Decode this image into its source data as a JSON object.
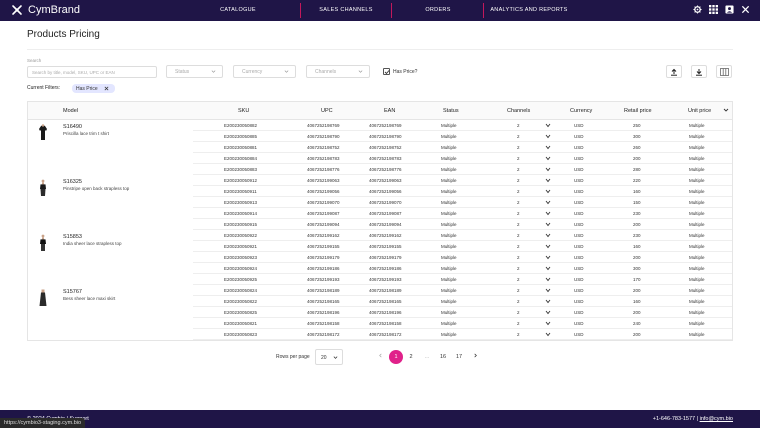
{
  "brand": {
    "name": "CymBrand"
  },
  "nav": {
    "items": [
      {
        "label": "CATALOGUE"
      },
      {
        "label": "SALES CHANNELS"
      },
      {
        "label": "ORDERS"
      },
      {
        "label": "ANALYTICS AND REPORTS"
      }
    ],
    "icons": [
      "gear-icon",
      "apps-grid-icon",
      "user-box-icon",
      "close-icon"
    ]
  },
  "page": {
    "title": "Products Pricing"
  },
  "search": {
    "label": "Search",
    "placeholder": "Search by title, model, SKU, UPC or EAN"
  },
  "filters": {
    "status": "Status",
    "currency": "Currency",
    "channels": "Channels",
    "has_price_checked": true,
    "has_price_label": "Has Price?"
  },
  "current_filters": {
    "label": "Current Filters:",
    "chips": [
      "Has Price"
    ]
  },
  "toolbar": {
    "buttons": [
      "upload-icon",
      "download-icon",
      "columns-icon"
    ]
  },
  "table": {
    "columns": [
      "Model",
      "SKU",
      "UPC",
      "EAN",
      "Status",
      "Channels",
      "Currency",
      "Retail price",
      "Unit price"
    ],
    "groups": [
      {
        "model": "S16490",
        "name": "Priscilla lace trim t shirt",
        "rows": [
          {
            "sku": "E200230050882",
            "upc": "4067252198769",
            "ean": "4067252198769",
            "status": "Multiple",
            "channels": "2",
            "currency": "USD",
            "retail": "250",
            "unit": "Multiple"
          },
          {
            "sku": "E200230050885",
            "upc": "4067252198790",
            "ean": "4067252198790",
            "status": "Multiple",
            "channels": "2",
            "currency": "USD",
            "retail": "300",
            "unit": "Multiple"
          },
          {
            "sku": "E200230050881",
            "upc": "4067252198752",
            "ean": "4067252198752",
            "status": "Multiple",
            "channels": "2",
            "currency": "USD",
            "retail": "260",
            "unit": "Multiple"
          },
          {
            "sku": "E200230050884",
            "upc": "4067252198783",
            "ean": "4067252198783",
            "status": "Multiple",
            "channels": "2",
            "currency": "USD",
            "retail": "200",
            "unit": "Multiple"
          },
          {
            "sku": "E200230050883",
            "upc": "4067252198776",
            "ean": "4067252198776",
            "status": "Multiple",
            "channels": "2",
            "currency": "USD",
            "retail": "280",
            "unit": "Multiple"
          }
        ]
      },
      {
        "model": "S16325",
        "name": "Pinstripe open back strapless top",
        "rows": [
          {
            "sku": "E200230050912",
            "upc": "4067252199063",
            "ean": "4067252199063",
            "status": "Multiple",
            "channels": "2",
            "currency": "USD",
            "retail": "220",
            "unit": "Multiple"
          },
          {
            "sku": "E200230050911",
            "upc": "4067252199056",
            "ean": "4067252199056",
            "status": "Multiple",
            "channels": "2",
            "currency": "USD",
            "retail": "160",
            "unit": "Multiple"
          },
          {
            "sku": "E200230050913",
            "upc": "4067252199070",
            "ean": "4067252199070",
            "status": "Multiple",
            "channels": "2",
            "currency": "USD",
            "retail": "150",
            "unit": "Multiple"
          },
          {
            "sku": "E200230050914",
            "upc": "4067252199087",
            "ean": "4067252199087",
            "status": "Multiple",
            "channels": "2",
            "currency": "USD",
            "retail": "230",
            "unit": "Multiple"
          },
          {
            "sku": "E200230050915",
            "upc": "4067252199094",
            "ean": "4067252199094",
            "status": "Multiple",
            "channels": "2",
            "currency": "USD",
            "retail": "200",
            "unit": "Multiple"
          }
        ]
      },
      {
        "model": "S15853",
        "name": "India sheer lace strapless top",
        "rows": [
          {
            "sku": "E200230050922",
            "upc": "4067252199162",
            "ean": "4067252199162",
            "status": "Multiple",
            "channels": "2",
            "currency": "USD",
            "retail": "230",
            "unit": "Multiple"
          },
          {
            "sku": "E200230050921",
            "upc": "4067252199155",
            "ean": "4067252199155",
            "status": "Multiple",
            "channels": "2",
            "currency": "USD",
            "retail": "160",
            "unit": "Multiple"
          },
          {
            "sku": "E200230050923",
            "upc": "4067252199179",
            "ean": "4067252199179",
            "status": "Multiple",
            "channels": "2",
            "currency": "USD",
            "retail": "200",
            "unit": "Multiple"
          },
          {
            "sku": "E200230050924",
            "upc": "4067252199186",
            "ean": "4067252199186",
            "status": "Multiple",
            "channels": "2",
            "currency": "USD",
            "retail": "300",
            "unit": "Multiple"
          },
          {
            "sku": "E200230050925",
            "upc": "4067252199193",
            "ean": "4067252199193",
            "status": "Multiple",
            "channels": "2",
            "currency": "USD",
            "retail": "170",
            "unit": "Multiple"
          }
        ]
      },
      {
        "model": "S15767",
        "name": "Bess sheer lace maxi skirt",
        "rows": [
          {
            "sku": "E200230050824",
            "upc": "4067252198189",
            "ean": "4067252198189",
            "status": "Multiple",
            "channels": "2",
            "currency": "USD",
            "retail": "200",
            "unit": "Multiple"
          },
          {
            "sku": "E200230050822",
            "upc": "4067252198165",
            "ean": "4067252198165",
            "status": "Multiple",
            "channels": "2",
            "currency": "USD",
            "retail": "160",
            "unit": "Multiple"
          },
          {
            "sku": "E200230050825",
            "upc": "4067252198196",
            "ean": "4067252198196",
            "status": "Multiple",
            "channels": "2",
            "currency": "USD",
            "retail": "200",
            "unit": "Multiple"
          },
          {
            "sku": "E200230050821",
            "upc": "4067252198158",
            "ean": "4067252198158",
            "status": "Multiple",
            "channels": "2",
            "currency": "USD",
            "retail": "240",
            "unit": "Multiple"
          },
          {
            "sku": "E200230050823",
            "upc": "4067252198172",
            "ean": "4067252198172",
            "status": "Multiple",
            "channels": "2",
            "currency": "USD",
            "retail": "200",
            "unit": "Multiple"
          }
        ]
      }
    ]
  },
  "pagination": {
    "rows_per_page_label": "Rows per page",
    "rows_per_page": "20",
    "pages": [
      "1",
      "2",
      "...",
      "16",
      "17"
    ],
    "active": "1"
  },
  "footer": {
    "left": "© 2024 Cymbio | Support",
    "phone": "+1-646-783-1577",
    "email": "info@cym.bio",
    "status_url": "https://cymbio3-staging.cym.bio"
  },
  "colors": {
    "nav_bg": "#1f1547",
    "accent": "#e0218a",
    "chip_bg": "#e3e6ff"
  }
}
